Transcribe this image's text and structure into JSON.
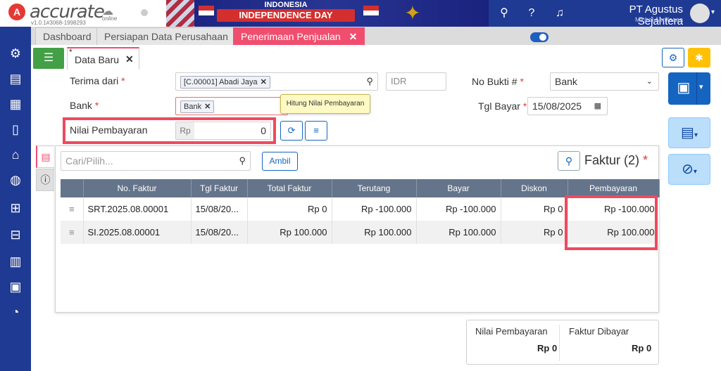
{
  "header": {
    "logo_text": "accurate",
    "logo_sub": "online",
    "version": "v1.0.1#3068-1998293",
    "banner_line1": "INDONESIA",
    "banner_line2": "INDEPENDENCE DAY",
    "company": "PT Agustus Sejahtera",
    "user": "Michel Aprillaaaa",
    "icons": [
      "search-icon",
      "help-icon",
      "bell-icon",
      "user-avatar"
    ]
  },
  "sidebar": {
    "icons": [
      "gear-icon",
      "inventory-icon",
      "building-icon",
      "ledger-icon",
      "bank-icon",
      "sales-icon",
      "cart-icon",
      "checkout-cart-icon",
      "report-icon",
      "tax-icon",
      "chart-icon"
    ]
  },
  "tabs": [
    {
      "label": "Dashboard"
    },
    {
      "label": "Persiapan Data Perusahaan"
    },
    {
      "label": "Penerimaan Penjualan"
    }
  ],
  "tab_counter": "3",
  "form": {
    "subtab_label": "Data Baru",
    "subtab_dirty_marker": "*",
    "terima_dari_label": "Terima dari",
    "terima_dari_value": "[C.00001] Abadi Jaya",
    "currency": "IDR",
    "no_bukti_label": "No Bukti #",
    "no_bukti_value": "Bank",
    "bank_label": "Bank",
    "bank_value": "Bank",
    "tgl_bayar_label": "Tgl Bayar",
    "tgl_bayar_value": "15/08/2025",
    "nilai_label": "Nilai Pembayaran",
    "nilai_prefix": "Rp",
    "nilai_value": "0",
    "tooltip": "Hitung Nilai Pembayaran",
    "required_marker": "*"
  },
  "detail": {
    "search_placeholder": "Cari/Pilih...",
    "ambil_label": "Ambil",
    "faktur_title": "Faktur (2)",
    "faktur_marker": "*",
    "columns": [
      "",
      "No. Faktur",
      "Tgl Faktur",
      "Total Faktur",
      "Terutang",
      "Bayar",
      "Diskon",
      "Pembayaran"
    ],
    "rows": [
      {
        "no": "SRT.2025.08.00001",
        "tgl": "15/08/20...",
        "total": "Rp 0",
        "terutang": "Rp -100.000",
        "bayar": "Rp -100.000",
        "diskon": "Rp 0",
        "pembayaran": "Rp -100.000"
      },
      {
        "no": "SI.2025.08.00001",
        "tgl": "15/08/20...",
        "total": "Rp 100.000",
        "terutang": "Rp 100.000",
        "bayar": "Rp 100.000",
        "diskon": "Rp 0",
        "pembayaran": "Rp 100.000"
      }
    ]
  },
  "summary": {
    "nilai_label": "Nilai Pembayaran",
    "nilai_value": "Rp 0",
    "faktur_label": "Faktur Dibayar",
    "faktur_value": "Rp 0"
  },
  "colors": {
    "brand_blue": "#1f3a93",
    "accent_pink": "#f04e6e",
    "highlight_red": "#ef4a5f"
  }
}
